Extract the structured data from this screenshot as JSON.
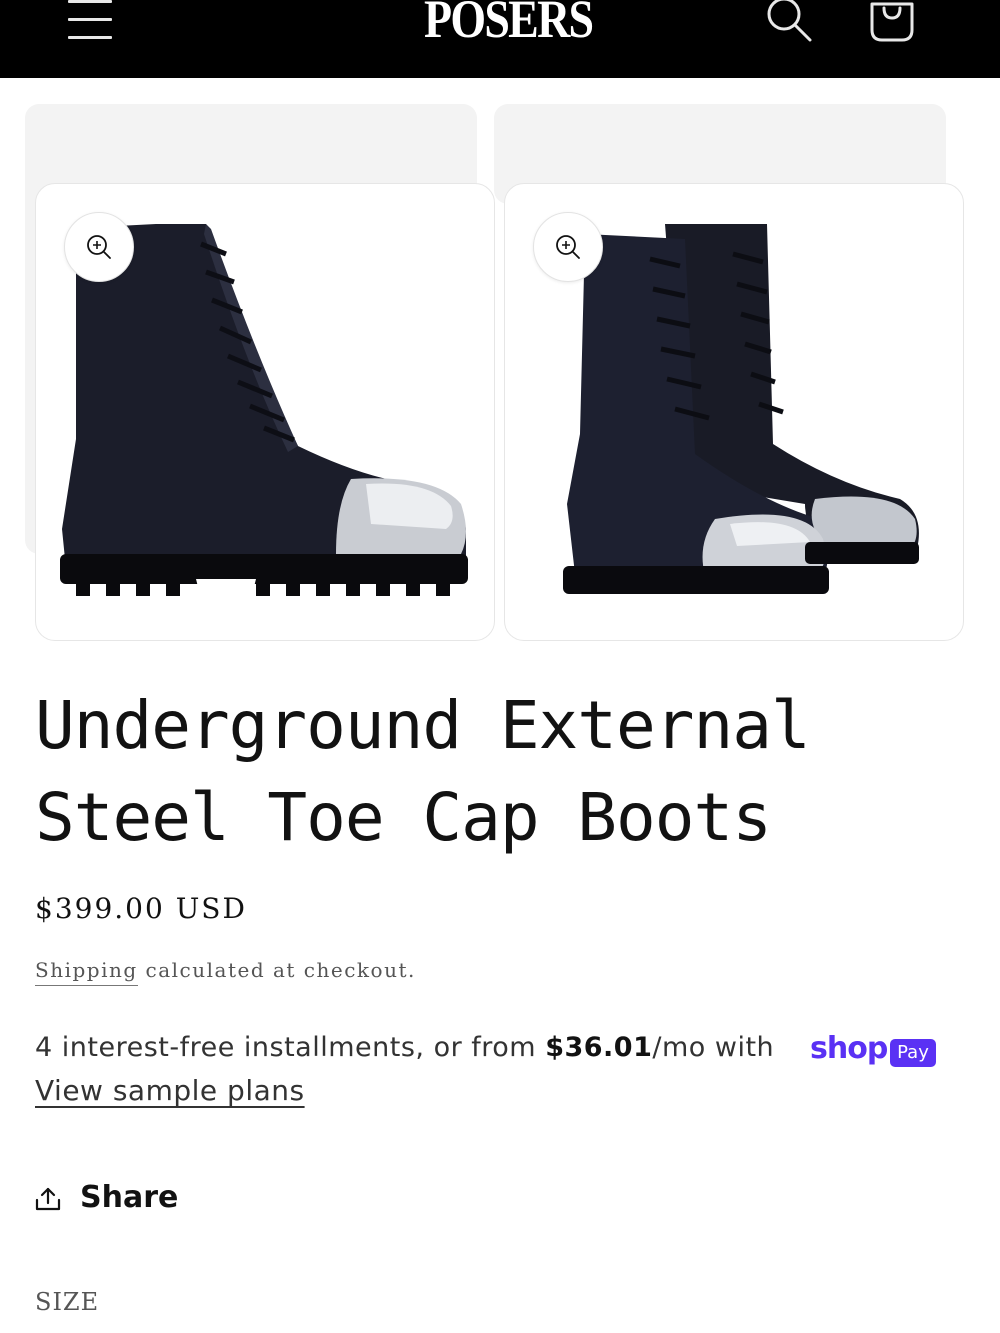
{
  "header": {
    "logo_text": "POSERS",
    "menu_icon": "hamburger-menu-icon",
    "search_icon": "search-icon",
    "cart_icon": "shopping-bag-icon"
  },
  "gallery": {
    "images": [
      {
        "alt": "Single black boot with steel toe cap, side view"
      },
      {
        "alt": "Pair of black lace-up boots with steel toe caps"
      }
    ],
    "zoom_icon": "zoom-in-icon"
  },
  "product": {
    "title": "Underground External Steel Toe Cap Boots",
    "price": "$399.00 USD",
    "shipping_link": "Shipping",
    "shipping_rest": " calculated at checkout."
  },
  "installments": {
    "prefix": "4 interest-free installments, or from ",
    "amount": "$36.01",
    "suffix": "/mo with",
    "shop_word": "shop",
    "pay_badge": "Pay",
    "view_plans": "View sample plans"
  },
  "share": {
    "label": "Share"
  },
  "size": {
    "label": "SIZE"
  },
  "colors": {
    "shop_pay": "#5a31f4",
    "header_bg": "#000000"
  }
}
